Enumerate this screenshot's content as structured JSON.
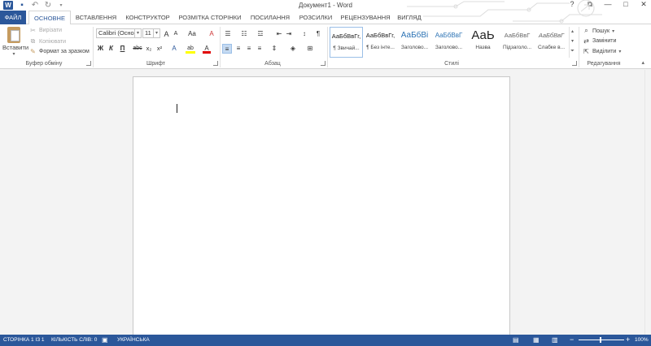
{
  "window": {
    "title": "Документ1 - Word",
    "help": "?",
    "ribbon_display": "⧉",
    "minimize": "—",
    "maximize": "□",
    "close": "✕"
  },
  "quick_access": {
    "logo": "W",
    "save": "💾",
    "undo": "↶",
    "redo": "↻"
  },
  "tabs": [
    {
      "label": "ФАЙЛ"
    },
    {
      "label": "ОСНОВНЕ"
    },
    {
      "label": "ВСТАВЛЕННЯ"
    },
    {
      "label": "КОНСТРУКТОР"
    },
    {
      "label": "РОЗМІТКА СТОРІНКИ"
    },
    {
      "label": "ПОСИЛАННЯ"
    },
    {
      "label": "РОЗСИЛКИ"
    },
    {
      "label": "РЕЦЕНЗУВАННЯ"
    },
    {
      "label": "ВИГЛЯД"
    }
  ],
  "clipboard": {
    "paste": "Вставити",
    "cut": "Вирізати",
    "copy": "Копіювати",
    "format_painter": "Формат за зразком",
    "group_label": "Буфер обміну"
  },
  "font": {
    "name": "Calibri (Основ",
    "size": "11",
    "grow": "A",
    "shrink": "A",
    "change_case": "Aa",
    "clear": "A",
    "bold": "Ж",
    "italic": "К",
    "underline": "П",
    "strike": "abc",
    "subscript": "x₂",
    "superscript": "x²",
    "effects": "A",
    "highlight": "ab",
    "color": "A",
    "group_label": "Шрифт"
  },
  "paragraph": {
    "pilcrow": "¶",
    "group_label": "Абзац"
  },
  "styles": {
    "items": [
      {
        "sample": "АаБбВвГг,",
        "name": "¶ Звичай..."
      },
      {
        "sample": "АаБбВвГг,",
        "name": "¶ Без інте..."
      },
      {
        "sample": "АаБбВі",
        "name": "Заголово..."
      },
      {
        "sample": "АаБбВвГ",
        "name": "Заголово..."
      },
      {
        "sample": "АаЬ",
        "name": "Назва"
      },
      {
        "sample": "АаБбВвГ",
        "name": "Підзаголо..."
      },
      {
        "sample": "АаБбВвГ",
        "name": "Слабке в..."
      }
    ],
    "group_label": "Стилі"
  },
  "editing": {
    "find": "Пошук",
    "replace": "Замінити",
    "select": "Виділити",
    "group_label": "Редагування"
  },
  "statusbar": {
    "page": "СТОРІНКА 1 ІЗ 1",
    "words": "КІЛЬКІСТЬ СЛІВ: 0",
    "language": "УКРАЇНСЬКА",
    "zoom": "100%",
    "zoom_minus": "−",
    "zoom_plus": "+"
  },
  "colors": {
    "accent": "#2b579a",
    "font_color": "#e00000",
    "highlight": "#ffff00"
  }
}
